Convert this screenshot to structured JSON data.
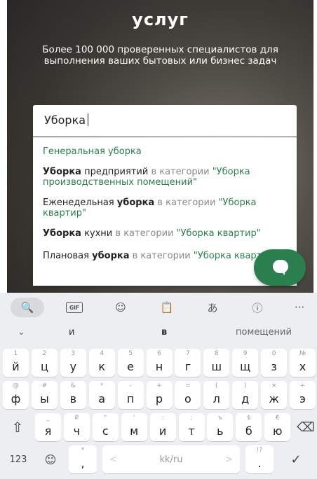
{
  "hero": {
    "title": "услуг",
    "subtitle": "Более 100 000 проверенных специалистов для выполнения ваших бытовых или бизнес задач"
  },
  "search": {
    "value": "Уборка"
  },
  "suggestions": [
    {
      "parts": [
        {
          "text": "Генеральная уборка",
          "style": "green"
        }
      ]
    },
    {
      "parts": [
        {
          "text": "Уборка",
          "style": "bold"
        },
        {
          "text": " предприятий",
          "style": "plain"
        },
        {
          "text": " в категории ",
          "style": "gray"
        },
        {
          "text": "\"Уборка производственных помещений\"",
          "style": "green"
        }
      ]
    },
    {
      "parts": [
        {
          "text": "Еженедельная ",
          "style": "plain"
        },
        {
          "text": "уборка",
          "style": "bold"
        },
        {
          "text": " в категории ",
          "style": "gray"
        },
        {
          "text": "\"Уборка квартир\"",
          "style": "green"
        }
      ]
    },
    {
      "parts": [
        {
          "text": "Уборка",
          "style": "bold"
        },
        {
          "text": " кухни",
          "style": "plain"
        },
        {
          "text": " в категории ",
          "style": "gray"
        },
        {
          "text": "\"Уборка квартир\"",
          "style": "green"
        }
      ]
    },
    {
      "parts": [
        {
          "text": "Плановая ",
          "style": "plain"
        },
        {
          "text": "уборка",
          "style": "bold"
        },
        {
          "text": " в категории ",
          "style": "gray"
        },
        {
          "text": "\"Уборка квартир\"",
          "style": "green"
        }
      ]
    }
  ],
  "chat_fab": {
    "icon": "chat-bubble-icon"
  },
  "keyboard": {
    "toolbar": [
      {
        "name": "search-icon",
        "glyph": "🔍"
      },
      {
        "name": "gif-icon",
        "glyph": "GIF"
      },
      {
        "name": "sticker-icon",
        "glyph": "☺"
      },
      {
        "name": "clipboard-icon",
        "glyph": "📋"
      },
      {
        "name": "translate-icon",
        "glyph": "あ"
      },
      {
        "name": "info-icon",
        "glyph": "ⓘ"
      },
      {
        "name": "more-icon",
        "glyph": "···"
      }
    ],
    "collapse_glyph": "⌄",
    "candidates": [
      "и",
      "в",
      "помещений"
    ],
    "row1": [
      {
        "hint": "1",
        "key": "й"
      },
      {
        "hint": "2",
        "key": "ц"
      },
      {
        "hint": "3",
        "key": "у"
      },
      {
        "hint": "4",
        "key": "к"
      },
      {
        "hint": "5",
        "key": "е"
      },
      {
        "hint": "6",
        "key": "н"
      },
      {
        "hint": "7",
        "key": "г"
      },
      {
        "hint": "8",
        "key": "ш"
      },
      {
        "hint": "9",
        "key": "щ"
      },
      {
        "hint": "0",
        "key": "з"
      },
      {
        "hint": "№",
        "key": "х"
      }
    ],
    "row2": [
      {
        "hint": "@",
        "key": "ф"
      },
      {
        "hint": "#",
        "key": "ы"
      },
      {
        "hint": "&",
        "key": "в"
      },
      {
        "hint": "*",
        "key": "а"
      },
      {
        "hint": "-",
        "key": "п"
      },
      {
        "hint": "+",
        "key": "р"
      },
      {
        "hint": "=",
        "key": "о"
      },
      {
        "hint": "(",
        "key": "л"
      },
      {
        "hint": ")",
        "key": "д"
      },
      {
        "hint": "×",
        "key": "ж"
      },
      {
        "hint": "÷",
        "key": "э"
      }
    ],
    "row3": [
      {
        "hint": "_",
        "key": "я"
      },
      {
        "hint": "₽",
        "key": "ч"
      },
      {
        "hint": "\"",
        "key": "с"
      },
      {
        "hint": "'",
        "key": "м"
      },
      {
        "hint": ":",
        "key": "и"
      },
      {
        "hint": ";",
        "key": "т"
      },
      {
        "hint": "ъ",
        "key": "ь"
      },
      {
        "hint": "$",
        "key": "б"
      },
      {
        "hint": "€",
        "key": "ю"
      }
    ],
    "shift_glyph": "⇧",
    "backspace_glyph": "⌫",
    "numbers_label": "123",
    "emoji_glyph": "☺",
    "comma_hint": "*",
    "comma_key": ",",
    "space_label": "kk/ru",
    "space_left": "<",
    "space_right": ">",
    "period_hint": "!?",
    "period_key": ".",
    "enter_glyph": "✓"
  }
}
